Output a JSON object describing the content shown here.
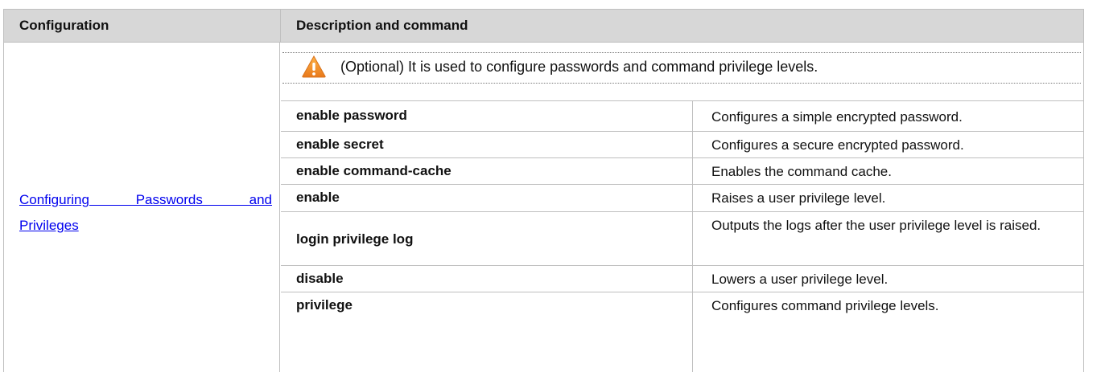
{
  "header": {
    "col_configuration": "Configuration",
    "col_description": "Description and command"
  },
  "configuration": {
    "link_line1": "Configuring Passwords and",
    "link_line2": "Privileges"
  },
  "note": {
    "icon": "warning-icon",
    "icon_color": "#f29b2a",
    "text": "(Optional) It is used to configure passwords and command privilege levels."
  },
  "commands": [
    {
      "command": "enable password",
      "description": "Configures a simple encrypted password."
    },
    {
      "command": "enable secret",
      "description": "Configures a secure encrypted password."
    },
    {
      "command": "enable command-cache",
      "description": "Enables the command cache."
    },
    {
      "command": "enable",
      "description": "Raises a user privilege level."
    },
    {
      "command": "login privilege log",
      "description": "Outputs the logs after the user privilege level is raised."
    },
    {
      "command": "disable",
      "description": "Lowers a user privilege level."
    },
    {
      "command": "privilege",
      "description": "Configures command privilege levels."
    }
  ]
}
